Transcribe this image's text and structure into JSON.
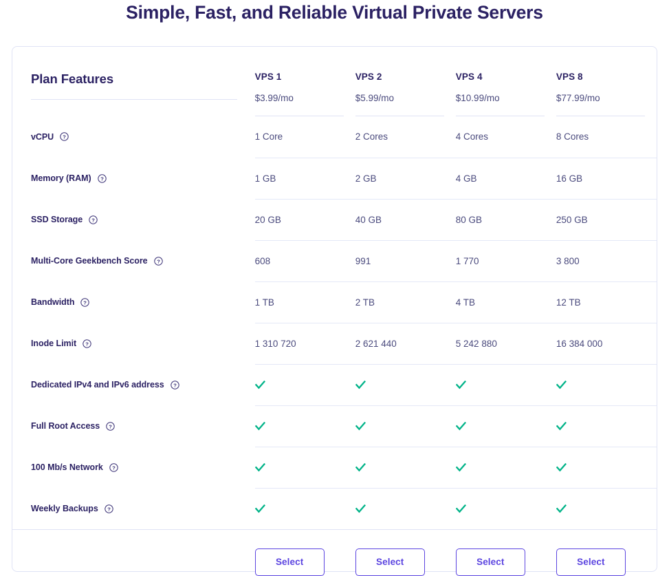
{
  "page": {
    "title": "Simple, Fast, and Reliable Virtual Private Servers",
    "title_color": "#2b2163",
    "accent_color": "#5b44e0",
    "check_color": "#00b388",
    "rule_color": "#dfe3f5"
  },
  "table": {
    "features_heading": "Plan Features",
    "plans": [
      {
        "name": "VPS 1",
        "price": "$3.99/mo",
        "select_label": "Select"
      },
      {
        "name": "VPS 2",
        "price": "$5.99/mo",
        "select_label": "Select"
      },
      {
        "name": "VPS 4",
        "price": "$10.99/mo",
        "select_label": "Select"
      },
      {
        "name": "VPS 8",
        "price": "$77.99/mo",
        "select_label": "Select"
      }
    ],
    "help_icon": "help-circle-icon",
    "check_icon": "check-icon",
    "rows": [
      {
        "label": "vCPU",
        "type": "text",
        "values": [
          "1 Core",
          "2 Cores",
          "4 Cores",
          "8 Cores"
        ]
      },
      {
        "label": "Memory (RAM)",
        "type": "text",
        "values": [
          "1 GB",
          "2 GB",
          "4 GB",
          "16 GB"
        ]
      },
      {
        "label": "SSD Storage",
        "type": "text",
        "values": [
          "20 GB",
          "40 GB",
          "80 GB",
          "250 GB"
        ]
      },
      {
        "label": "Multi-Core Geekbench Score",
        "type": "text",
        "values": [
          "608",
          "991",
          "1 770",
          "3 800"
        ]
      },
      {
        "label": "Bandwidth",
        "type": "text",
        "values": [
          "1 TB",
          "2 TB",
          "4 TB",
          "12 TB"
        ]
      },
      {
        "label": "Inode Limit",
        "type": "text",
        "values": [
          "1 310 720",
          "2 621 440",
          "5 242 880",
          "16 384 000"
        ]
      },
      {
        "label": "Dedicated IPv4 and IPv6 address",
        "type": "check",
        "values": [
          true,
          true,
          true,
          true
        ]
      },
      {
        "label": "Full Root Access",
        "type": "check",
        "values": [
          true,
          true,
          true,
          true
        ]
      },
      {
        "label": "100 Mb/s Network",
        "type": "check",
        "values": [
          true,
          true,
          true,
          true
        ]
      },
      {
        "label": "Weekly Backups",
        "type": "check",
        "values": [
          true,
          true,
          true,
          true
        ]
      }
    ]
  }
}
